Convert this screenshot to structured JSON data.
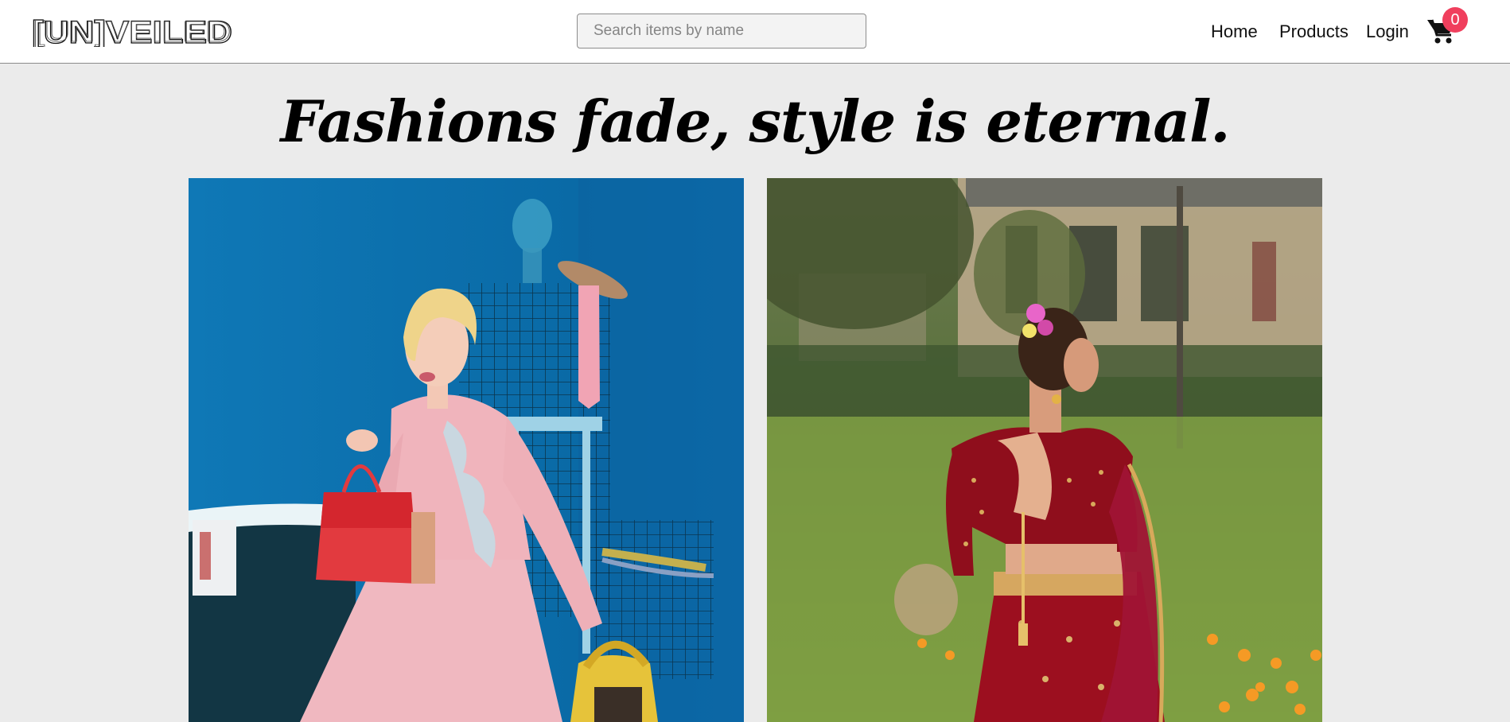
{
  "header": {
    "logo_text": "[UN]VEILED",
    "search": {
      "placeholder": "Search items by name",
      "value": ""
    },
    "nav": {
      "home": "Home",
      "products": "Products",
      "login": "Login"
    },
    "cart": {
      "icon": "shopping-cart-icon",
      "count": "0"
    }
  },
  "hero": {
    "tagline": "Fashions fade, style is eternal."
  },
  "colors": {
    "page_background": "#ebebeb",
    "navbar_background": "#ffffff",
    "badge": "#f03f5d",
    "text": "#111111"
  }
}
